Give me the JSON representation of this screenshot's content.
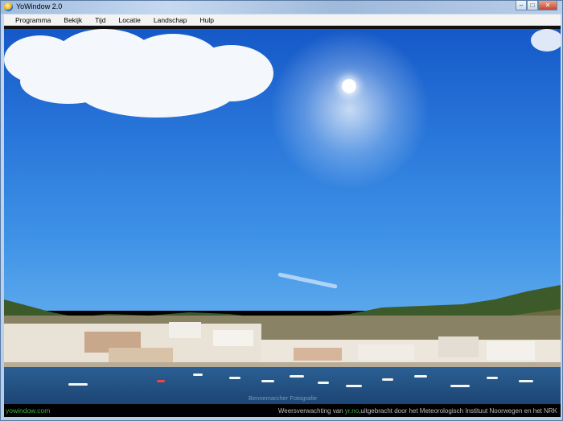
{
  "window": {
    "title": "YoWindow 2.0",
    "minimize_glyph": "–",
    "maximize_glyph": "□",
    "close_glyph": "✕"
  },
  "menu": {
    "items": [
      "Programma",
      "Bekijk",
      "Tijd",
      "Locatie",
      "Landschap",
      "Hulp"
    ]
  },
  "scene": {
    "photo_credit": "Bennemarcher Fotografie"
  },
  "status": {
    "site_link": "yowindow.com",
    "forecast_prefix": "Weersverwachting van ",
    "forecast_link": "yr.no",
    "forecast_suffix": ",uitgebracht door het Meteorologisch Instituut Noorwegen en het NRK"
  },
  "colors": {
    "link_green": "#3fae3f",
    "sky_top": "#1559c8",
    "sea": "#1c4574"
  }
}
